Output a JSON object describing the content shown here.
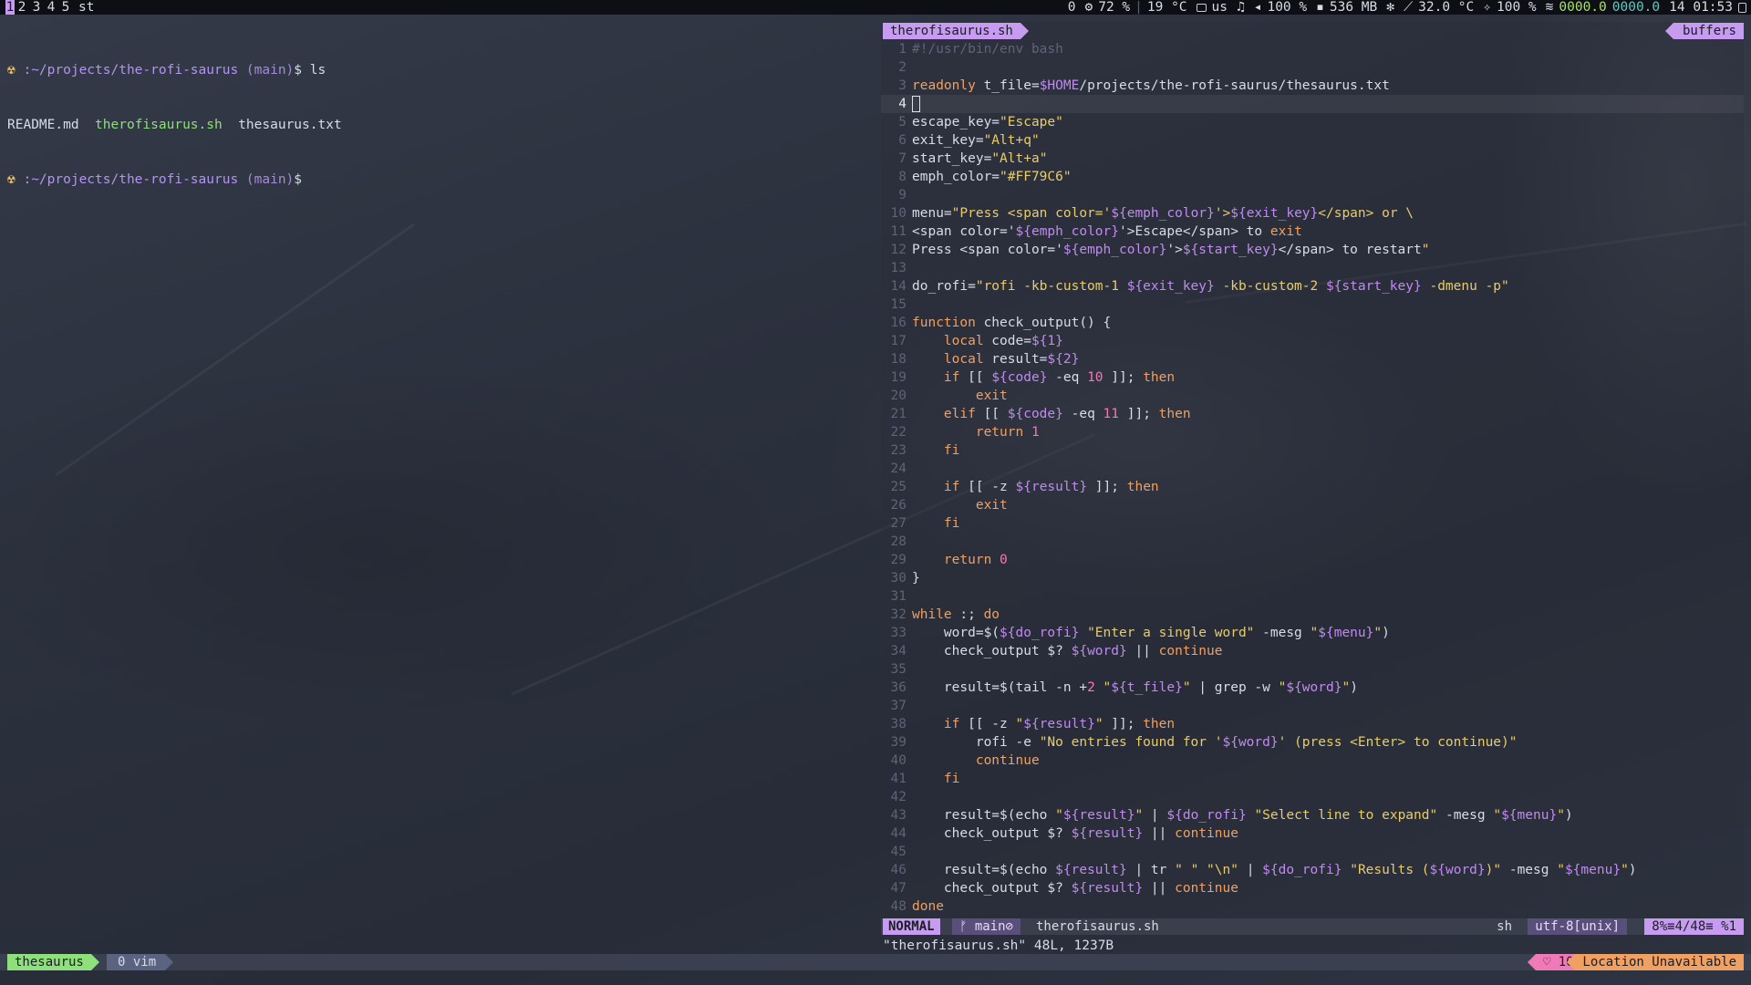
{
  "topbar": {
    "workspaces": [
      "1",
      "2",
      "3",
      "4",
      "5"
    ],
    "active_window": "st",
    "updates": "0",
    "cpu": "72 %",
    "weather": "19 °C",
    "keyboard": "us",
    "volume": "100 %",
    "memory": "536 MB",
    "temperature": "32.0 °C",
    "brightness": "100 %",
    "net_down": "0000.0",
    "net_up": "0000.0",
    "clock": "14 01:53"
  },
  "terminal": {
    "prompt_symbol": "☢",
    "path": ":~/projects/the-rofi-saurus",
    "branch": "(main)",
    "dollar": "$",
    "command": "ls",
    "files": [
      "README.md",
      "therofisaurus.sh",
      "thesaurus.txt"
    ]
  },
  "editor": {
    "tab_name": "therofisaurus.sh",
    "buffers_label": "buffers",
    "lines": [
      "#!/usr/bin/env bash",
      "",
      "readonly t_file=$HOME/projects/the-rofi-saurus/thesaurus.txt",
      "",
      "escape_key=\"Escape\"",
      "exit_key=\"Alt+q\"",
      "start_key=\"Alt+a\"",
      "emph_color=\"#FF79C6\"",
      "",
      "menu=\"Press <span color='${emph_color}'>${exit_key}</span> or \\",
      "<span color='${emph_color}'>Escape</span> to exit",
      "Press <span color='${emph_color}'>${start_key}</span> to restart\"",
      "",
      "do_rofi=\"rofi -kb-custom-1 ${exit_key} -kb-custom-2 ${start_key} -dmenu -p\"",
      "",
      "function check_output() {",
      "    local code=${1}",
      "    local result=${2}",
      "    if [[ ${code} -eq 10 ]]; then",
      "        exit",
      "    elif [[ ${code} -eq 11 ]]; then",
      "        return 1",
      "    fi",
      "",
      "    if [[ -z ${result} ]]; then",
      "        exit",
      "    fi",
      "",
      "    return 0",
      "}",
      "",
      "while :; do",
      "    word=$(${do_rofi} \"Enter a single word\" -mesg \"${menu}\")",
      "    check_output $? ${word} || continue",
      "",
      "    result=$(tail -n +2 \"${t_file}\" | grep -w \"${word}\")",
      "",
      "    if [[ -z \"${result}\" ]]; then",
      "        rofi -e \"No entries found for '${word}' (press <Enter> to continue)\"",
      "        continue",
      "    fi",
      "",
      "    result=$(echo \"${result}\" | ${do_rofi} \"Select line to expand\" -mesg \"${menu}\")",
      "    check_output $? ${result} || continue",
      "",
      "    result=$(echo ${result} | tr \" \" \"\\n\" | ${do_rofi} \"Results (${word})\" -mesg \"${menu}\")",
      "    check_output $? ${result} || continue",
      "done"
    ],
    "current_line": 4
  },
  "statusline": {
    "mode": "NORMAL",
    "branch": "ᚠ main⊘",
    "file": "therofisaurus.sh",
    "filetype": "sh",
    "encoding": "utf-8[unix]",
    "position": "8%≡4/48≡ %1"
  },
  "cmdline": "\"therofisaurus.sh\" 48L, 1237B",
  "tmux": {
    "session": "thesaurus",
    "window": "0 vim",
    "battery": "♡ 100",
    "location": "Location Unavailable"
  },
  "colors": {
    "accent": "#c79cf0",
    "green": "#8ee07a",
    "pink": "#f07ab8",
    "orange": "#f0a060",
    "string": "#e8cc6a"
  }
}
